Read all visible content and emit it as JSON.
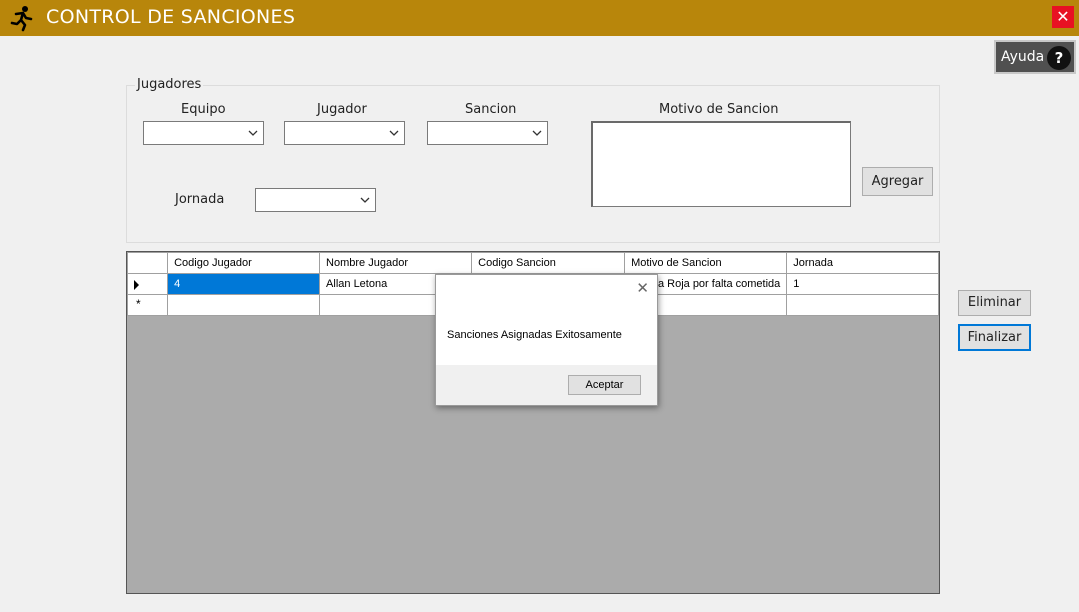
{
  "window": {
    "title": "CONTROL DE SANCIONES",
    "close_glyph": "✕"
  },
  "help": {
    "label": "Ayuda",
    "icon_glyph": "?"
  },
  "form": {
    "group_label": "Jugadores",
    "equipo_label": "Equipo",
    "jugador_label": "Jugador",
    "sancion_label": "Sancion",
    "motivo_label": "Motivo de Sancion",
    "jornada_label": "Jornada",
    "agregar_label": "Agregar"
  },
  "grid": {
    "columns": [
      "Codigo Jugador",
      "Nombre Jugador",
      "Codigo Sancion",
      "Motivo de Sancion",
      "Jornada"
    ],
    "rows": [
      {
        "codigo_jugador": "4",
        "nombre_jugador": "Allan Letona",
        "codigo_sancion": "",
        "motivo": "Tarjeta Roja por falta cometida",
        "jornada": "1"
      }
    ],
    "new_row_glyph": "*"
  },
  "side": {
    "eliminar_label": "Eliminar",
    "finalizar_label": "Finalizar"
  },
  "dialog": {
    "message": "Sanciones Asignadas Exitosamente",
    "ok_label": "Aceptar",
    "close_glyph": "✕"
  },
  "colors": {
    "titlebar": "#b8860b",
    "selection": "#0078d7",
    "close": "#e81123"
  }
}
